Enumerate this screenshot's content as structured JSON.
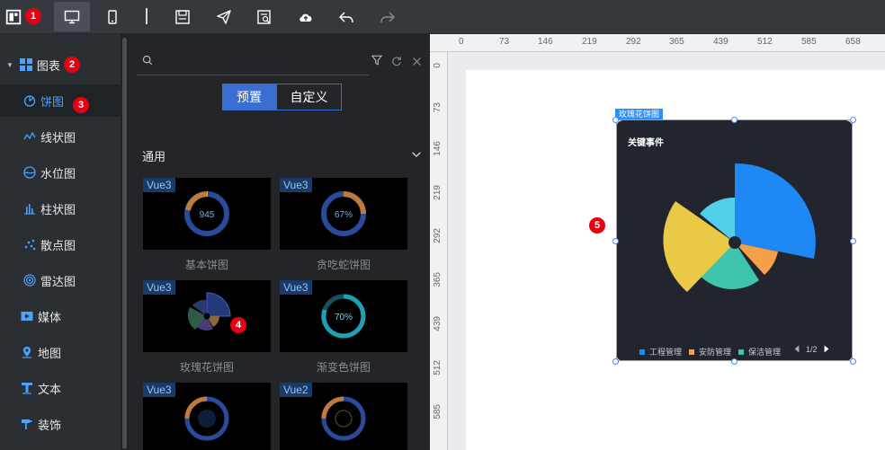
{
  "toolbar": {
    "badge": "1"
  },
  "sidebar": {
    "group_label": "图表",
    "group_badge": "2",
    "items": [
      {
        "label": "饼图",
        "badge": "3"
      },
      {
        "label": "线状图"
      },
      {
        "label": "水位图"
      },
      {
        "label": "柱状图"
      },
      {
        "label": "散点图"
      },
      {
        "label": "雷达图"
      }
    ],
    "groups": [
      {
        "label": "媒体"
      },
      {
        "label": "地图"
      },
      {
        "label": "文本"
      },
      {
        "label": "装饰"
      }
    ]
  },
  "panel": {
    "tab_preset": "预置",
    "tab_custom": "自定义",
    "category": "通用",
    "cards": [
      {
        "tag": "Vue3",
        "label": "基本饼图",
        "center": "945"
      },
      {
        "tag": "Vue3",
        "label": "贪吃蛇饼图",
        "center": "67%"
      },
      {
        "tag": "Vue3",
        "label": "玫瑰花饼图",
        "badge": "4"
      },
      {
        "tag": "Vue3",
        "label": "渐变色饼图",
        "center": "70%"
      },
      {
        "tag": "Vue3"
      },
      {
        "tag": "Vue2"
      }
    ]
  },
  "ruler": {
    "top": [
      "0",
      "73",
      "146",
      "219",
      "292",
      "365",
      "439",
      "512",
      "585",
      "658"
    ],
    "left": [
      "0",
      "73",
      "146",
      "219",
      "292",
      "365",
      "439",
      "512",
      "585"
    ]
  },
  "canvas": {
    "badge": "5",
    "widget_tag": "玫瑰花饼图",
    "widget_title": "关键事件",
    "legend": [
      {
        "name": "工程管理",
        "color": "#1e88f5"
      },
      {
        "name": "安防管理",
        "color": "#f4a04a"
      },
      {
        "name": "保洁管理",
        "color": "#3ec4ac"
      }
    ],
    "pager": "1/2"
  },
  "colors": {
    "accent": "#4aa3ff",
    "badge": "#e60012",
    "rose_blue": "#1e88f5",
    "rose_orange": "#f4a04a",
    "rose_teal": "#3ec4ac",
    "rose_yellow": "#eac946",
    "rose_cyan": "#4fd0e8"
  }
}
